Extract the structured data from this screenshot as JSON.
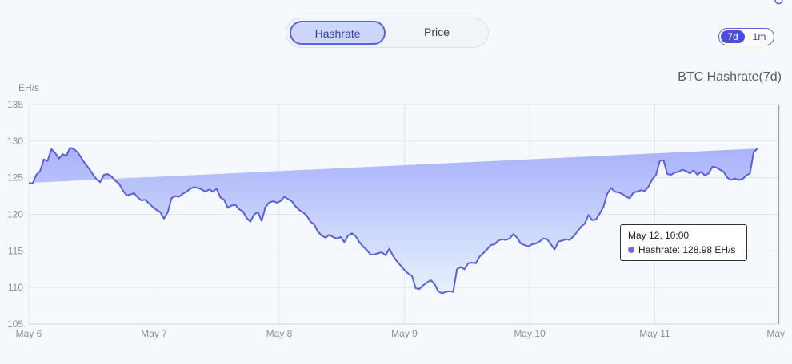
{
  "toggle": {
    "active": "Hashrate",
    "inactive": "Price"
  },
  "range": {
    "active": "7d",
    "inactive": "1m"
  },
  "colors": {
    "line": "#5b5fd9",
    "fill_top": "#a9b2fb",
    "fill_bottom": "#e6f2fb",
    "grid": "#e2e6ee",
    "tooltip_dot": "#6a6cf0"
  },
  "tooltip": {
    "date": "May 12, 10:00",
    "series": "Hashrate:",
    "value": "128.98 EH/s"
  },
  "chart_data": {
    "type": "area",
    "title": "BTC Hashrate(7d)",
    "ylabel": "EH/s",
    "xlabel": "",
    "ylim": [
      105,
      135
    ],
    "yticks": [
      105,
      110,
      115,
      120,
      125,
      130,
      135
    ],
    "xlim": [
      0,
      6
    ],
    "xticks": [
      {
        "x": 0,
        "label": "May 6"
      },
      {
        "x": 1,
        "label": "May 7"
      },
      {
        "x": 2,
        "label": "May 8"
      },
      {
        "x": 3,
        "label": "May 9"
      },
      {
        "x": 4,
        "label": "May 10"
      },
      {
        "x": 5,
        "label": "May 11"
      },
      {
        "x": 6,
        "label": "May"
      }
    ],
    "grid": true,
    "x": [
      0.0,
      0.03,
      0.06,
      0.09,
      0.12,
      0.15,
      0.18,
      0.21,
      0.24,
      0.27,
      0.3,
      0.33,
      0.36,
      0.39,
      0.42,
      0.45,
      0.48,
      0.51,
      0.54,
      0.57,
      0.6,
      0.63,
      0.66,
      0.69,
      0.72,
      0.75,
      0.78,
      0.81,
      0.84,
      0.87,
      0.9,
      0.93,
      0.96,
      0.99,
      1.02,
      1.05,
      1.08,
      1.11,
      1.14,
      1.17,
      1.2,
      1.23,
      1.26,
      1.29,
      1.32,
      1.35,
      1.38,
      1.41,
      1.44,
      1.47,
      1.5,
      1.53,
      1.56,
      1.59,
      1.62,
      1.65,
      1.68,
      1.71,
      1.74,
      1.77,
      1.8,
      1.83,
      1.86,
      1.89,
      1.92,
      1.95,
      1.98,
      2.01,
      2.04,
      2.07,
      2.1,
      2.13,
      2.16,
      2.19,
      2.22,
      2.25,
      2.28,
      2.31,
      2.34,
      2.37,
      2.4,
      2.43,
      2.46,
      2.49,
      2.52,
      2.55,
      2.58,
      2.61,
      2.64,
      2.67,
      2.7,
      2.73,
      2.76,
      2.79,
      2.82,
      2.85,
      2.88,
      2.91,
      2.94,
      2.97,
      3.0,
      3.03,
      3.06,
      3.09,
      3.12,
      3.15,
      3.18,
      3.21,
      3.24,
      3.27,
      3.3,
      3.33,
      3.36,
      3.39,
      3.42,
      3.45,
      3.48,
      3.51,
      3.54,
      3.57,
      3.6,
      3.63,
      3.66,
      3.69,
      3.72,
      3.75,
      3.78,
      3.81,
      3.84,
      3.87,
      3.9,
      3.93,
      3.96,
      3.99,
      4.02,
      4.05,
      4.08,
      4.11,
      4.14,
      4.17,
      4.2,
      4.23,
      4.26,
      4.29,
      4.32,
      4.35,
      4.38,
      4.41,
      4.44,
      4.47,
      4.5,
      4.53,
      4.56,
      4.59,
      4.62,
      4.65,
      4.68,
      4.71,
      4.74,
      4.77,
      4.8,
      4.83,
      4.86,
      4.89,
      4.92,
      4.95,
      4.98,
      5.01,
      5.04,
      5.07,
      5.1,
      5.13,
      5.16,
      5.19,
      5.22,
      5.25,
      5.28,
      5.31,
      5.34,
      5.37,
      5.4,
      5.43,
      5.46,
      5.49,
      5.52,
      5.55,
      5.58,
      5.61,
      5.64,
      5.67,
      5.7,
      5.73,
      5.76,
      5.79,
      5.82,
      5.85,
      5.88,
      5.91,
      5.93,
      5.95,
      5.97,
      5.99
    ],
    "series": [
      {
        "values": [
          124.3,
          124.2,
          125.4,
          125.9,
          127.5,
          127.3,
          128.9,
          128.4,
          127.6,
          128.2,
          128.0,
          129.1,
          128.9,
          128.5,
          127.7,
          126.9,
          126.3,
          125.5,
          124.8,
          124.4,
          125.4,
          125.5,
          125.2,
          124.6,
          124.2,
          123.3,
          122.6,
          122.7,
          122.9,
          122.3,
          121.9,
          122.0,
          121.5,
          121.0,
          120.6,
          120.3,
          119.4,
          120.3,
          122.2,
          122.5,
          122.4,
          122.8,
          123.1,
          123.5,
          123.7,
          123.6,
          123.4,
          123.1,
          123.4,
          123.1,
          123.5,
          122.3,
          122.0,
          120.9,
          121.2,
          121.3,
          120.7,
          120.4,
          119.5,
          119.0,
          120.0,
          120.3,
          119.1,
          121.0,
          121.6,
          121.8,
          121.6,
          121.8,
          122.4,
          122.1,
          121.8,
          121.1,
          120.6,
          120.3,
          119.8,
          119.0,
          118.6,
          117.6,
          117.1,
          116.8,
          117.2,
          116.9,
          116.7,
          116.9,
          116.2,
          117.1,
          117.4,
          117.0,
          116.2,
          115.6,
          115.1,
          114.5,
          114.5,
          114.7,
          114.8,
          114.4,
          115.3,
          114.3,
          113.6,
          113.0,
          112.4,
          111.9,
          111.6,
          109.9,
          109.8,
          110.3,
          110.7,
          111.0,
          110.5,
          109.5,
          109.2,
          109.4,
          109.5,
          109.4,
          112.5,
          112.8,
          112.5,
          113.3,
          113.4,
          113.3,
          114.2,
          114.7,
          115.2,
          115.8,
          115.9,
          116.4,
          116.6,
          116.5,
          116.7,
          117.3,
          116.8,
          116.0,
          115.8,
          115.6,
          115.9,
          116.0,
          116.3,
          116.7,
          116.6,
          115.9,
          115.2,
          116.3,
          116.4,
          116.6,
          116.5,
          117.0,
          117.6,
          118.3,
          118.7,
          119.9,
          119.2,
          119.3,
          120.1,
          121.0,
          122.8,
          123.6,
          123.1,
          123.0,
          122.8,
          122.4,
          122.2,
          123.0,
          123.1,
          123.3,
          123.2,
          123.8,
          124.8,
          125.4,
          127.3,
          127.4,
          125.5,
          125.4,
          125.7,
          125.8,
          126.1,
          125.9,
          125.6,
          126.0,
          125.4,
          125.8,
          125.3,
          125.6,
          126.5,
          126.4,
          126.1,
          125.8,
          125.0,
          124.7,
          124.9,
          124.7,
          124.8,
          125.3,
          125.6,
          128.5,
          128.98
        ]
      }
    ]
  }
}
